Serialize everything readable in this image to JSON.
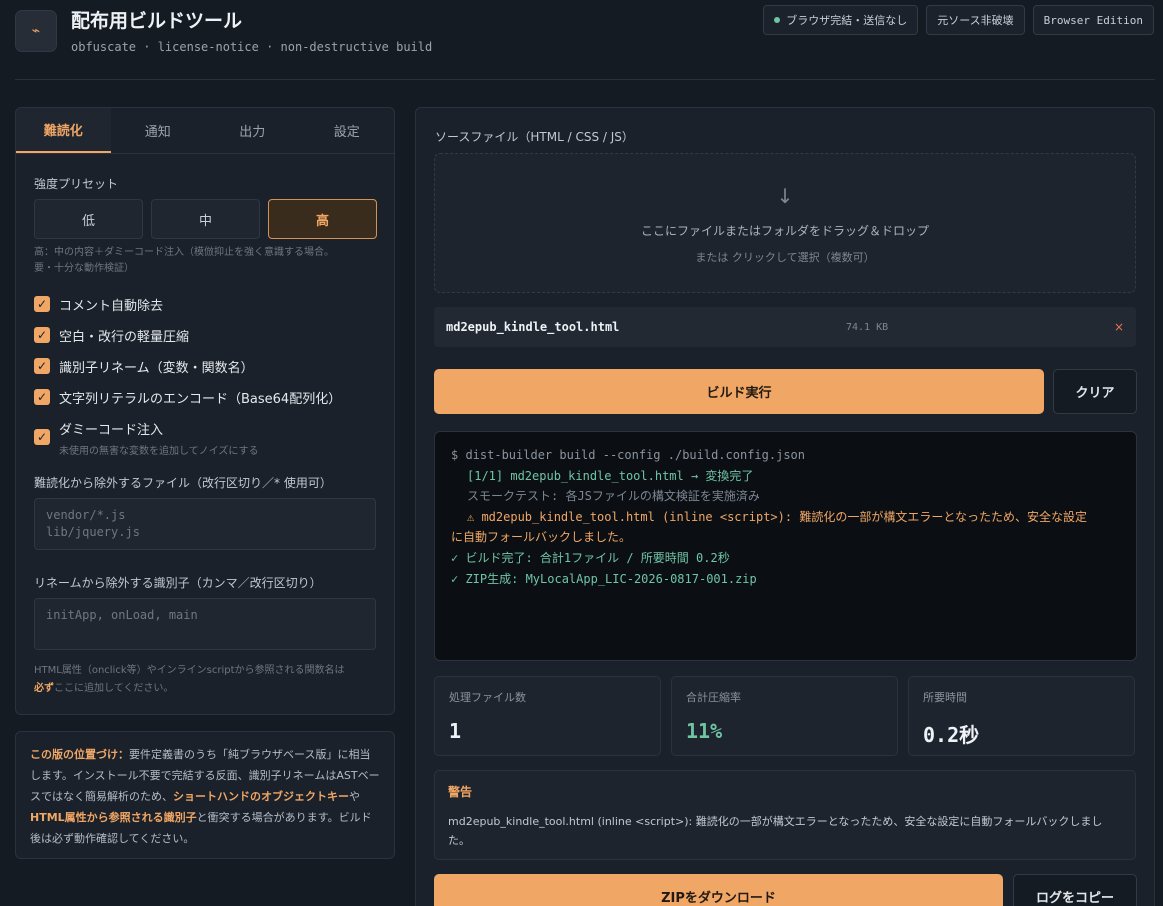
{
  "header": {
    "logo_icon": "wand-icon",
    "logo_glyph": "⌁",
    "title": "配布用ビルドツール",
    "subtitle": "obfuscate · license-notice · non-destructive build",
    "badges": [
      "ブラウザ完結・送信なし",
      "元ソース非破壊",
      "Browser Edition"
    ],
    "status_color": "#6fc4a4"
  },
  "tabs": [
    "難読化",
    "通知",
    "出力",
    "設定"
  ],
  "active_tab": "難読化",
  "preset": {
    "label": "強度プリセット",
    "options": [
      "低",
      "中",
      "高"
    ],
    "selected": "高",
    "hint_line1": "高：中の内容＋ダミーコード注入（模倣抑止を強く意識する場合。",
    "hint_line2": "要・十分な動作検証）"
  },
  "options": [
    {
      "label": "コメント自動除去",
      "checked": true
    },
    {
      "label": "空白・改行の軽量圧縮",
      "checked": true
    },
    {
      "label": "識別子リネーム（変数・関数名）",
      "checked": true
    },
    {
      "label": "文字列リテラルのエンコード（Base64配列化）",
      "checked": true
    },
    {
      "label": "ダミーコード注入",
      "desc": "未使用の無害な変数を追加してノイズにする",
      "checked": true
    }
  ],
  "exclude_files": {
    "label": "難読化から除外するファイル（改行区切り／* 使用可）",
    "placeholder_line1": "vendor/*.js",
    "placeholder_line2": "lib/jquery.js"
  },
  "exclude_ids": {
    "label": "リネームから除外する識別子（カンマ／改行区切り）",
    "placeholder": "initApp, onLoad, main"
  },
  "footnote": {
    "line1": "HTML属性（onclick等）やインラインscriptから参照される関数名は",
    "strong": "必ず",
    "line2": "ここに追加してください。"
  },
  "info": {
    "strong1": "この版の位置づけ：",
    "text1": "要件定義書のうち「純ブラウザベース版」に相当します。インストール不要で完結する反面、識別子リネームはASTベースではなく簡易解析のため、",
    "strong2": "ショートハンドのオブジェクトキー",
    "text2": "や",
    "strong3": "HTML属性から参照される識別子",
    "text3": "と衝突する場合があります。ビルド後は必ず動作確認してください。"
  },
  "source": {
    "label": "ソースファイル（HTML / CSS / JS）",
    "drop_icon": "arrow-down-icon",
    "drop_text": "ここにファイルまたはフォルダをドラッグ＆ドロップ",
    "drop_sub": "または クリックして選択（複数可）",
    "file_name": "md2epub_kindle_tool.html",
    "file_size": "74.1 KB",
    "remove_glyph": "×"
  },
  "buttons": {
    "build": "ビルド実行",
    "clear": "クリア",
    "zip": "ZIPをダウンロード",
    "copy_log": "ログをコピー"
  },
  "console": {
    "cmd": "$ dist-builder build --config ./build.config.json",
    "line1": "[1/1] md2epub_kindle_tool.html → 変換完了",
    "line2": "スモークテスト: 各JSファイルの構文検証を実施済み",
    "warn_a": "⚠ md2epub_kindle_tool.html (inline <script>): 難読化の一部が構文エラーとなったため、安全な設定",
    "warn_b": "に自動フォールバックしました。",
    "ok1": "✓ ビルド完了: 合計1ファイル / 所要時間 0.2秒",
    "ok2": "✓ ZIP生成: MyLocalApp_LIC-2026-0817-001.zip"
  },
  "stats": [
    {
      "label": "処理ファイル数",
      "value": "1"
    },
    {
      "label": "合計圧縮率",
      "value": "11%"
    },
    {
      "label": "所要時間",
      "value": "0.2秒"
    }
  ],
  "warning": {
    "title": "警告",
    "text": "md2epub_kindle_tool.html (inline <script>): 難読化の一部が構文エラーとなったため、安全な設定に自動フォールバックしました。"
  },
  "colors": {
    "accent": "#f0a664",
    "success": "#6fc4a4",
    "background": "#151b23"
  }
}
